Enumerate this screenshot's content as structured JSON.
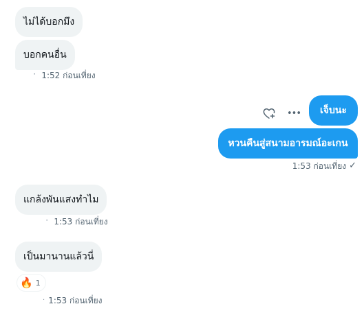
{
  "messages": [
    {
      "text": "ไม่ได้บอกมึง"
    },
    {
      "text": "บอกคนอื่น",
      "meta_dots": "⠂",
      "timestamp": "1:52 ก่อนเที่ยง"
    },
    {
      "text": "เจ็บนะ"
    },
    {
      "text": "หวนคืนสู่สนามอารมณ์อะเกน",
      "timestamp": "1:53 ก่อนเที่ยง",
      "status_icon": "✓"
    },
    {
      "text": "แกล้งพันแสงทำไม",
      "meta_dots": "⠂",
      "timestamp": "1:53 ก่อนเที่ยง"
    },
    {
      "text": "เป็นมานานแล้วนี่",
      "meta_dots": "·",
      "timestamp": "1:53 ก่อนเที่ยง"
    }
  ],
  "reaction": {
    "emoji": "🔥",
    "count": "1"
  },
  "actions": {
    "react_icon": "heart-plus-icon",
    "more_icon": "more-options-icon",
    "more_glyph": "•••"
  },
  "colors": {
    "outgoing_bubble": "#1d9bf0",
    "incoming_bubble": "#eff3f4",
    "meta_text": "#536471"
  }
}
